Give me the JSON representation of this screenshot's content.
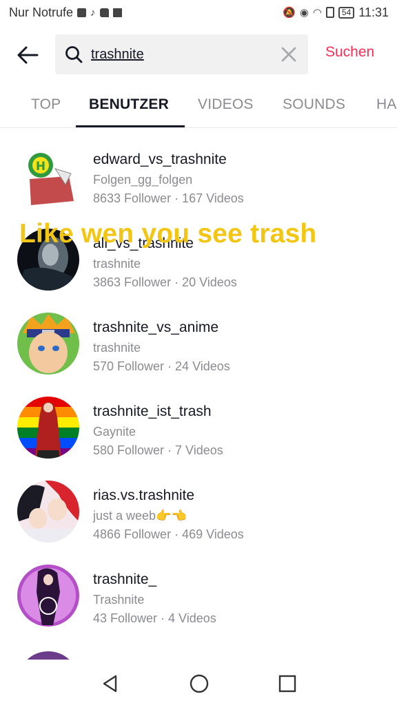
{
  "status_bar": {
    "carrier": "Nur Notrufe",
    "battery": "54",
    "time": "11:31"
  },
  "search": {
    "query": "trashnite",
    "submit_label": "Suchen"
  },
  "tabs": [
    {
      "label": "TOP",
      "active": false
    },
    {
      "label": "BENUTZER",
      "active": true
    },
    {
      "label": "VIDEOS",
      "active": false
    },
    {
      "label": "SOUNDS",
      "active": false
    },
    {
      "label": "HA",
      "active": false
    }
  ],
  "users": [
    {
      "name": "edward_vs_trashnite",
      "nickname": "Folgen_gg_folgen",
      "stats": "8633 Follower · 167 Videos"
    },
    {
      "name": "all_vs_trashnite",
      "nickname": "trashnite",
      "stats": "3863 Follower · 20 Videos"
    },
    {
      "name": "trashnite_vs_anime",
      "nickname": "trashnite",
      "stats": "570 Follower · 24 Videos"
    },
    {
      "name": "trashnite_ist_trash",
      "nickname": "Gaynite",
      "stats": "580 Follower · 7 Videos"
    },
    {
      "name": "rias.vs.trashnite",
      "nickname": "just a weeb👉👈",
      "stats": "4866 Follower · 469 Videos"
    },
    {
      "name": "trashnite_",
      "nickname": "Trashnite",
      "stats": "43 Follower · 4 Videos"
    }
  ],
  "overlay_caption": "Like wen you see trash",
  "colors": {
    "accent": "#fe2c55",
    "caption": "#f3c614",
    "text_primary": "#161823",
    "text_secondary": "#8a8b91"
  }
}
